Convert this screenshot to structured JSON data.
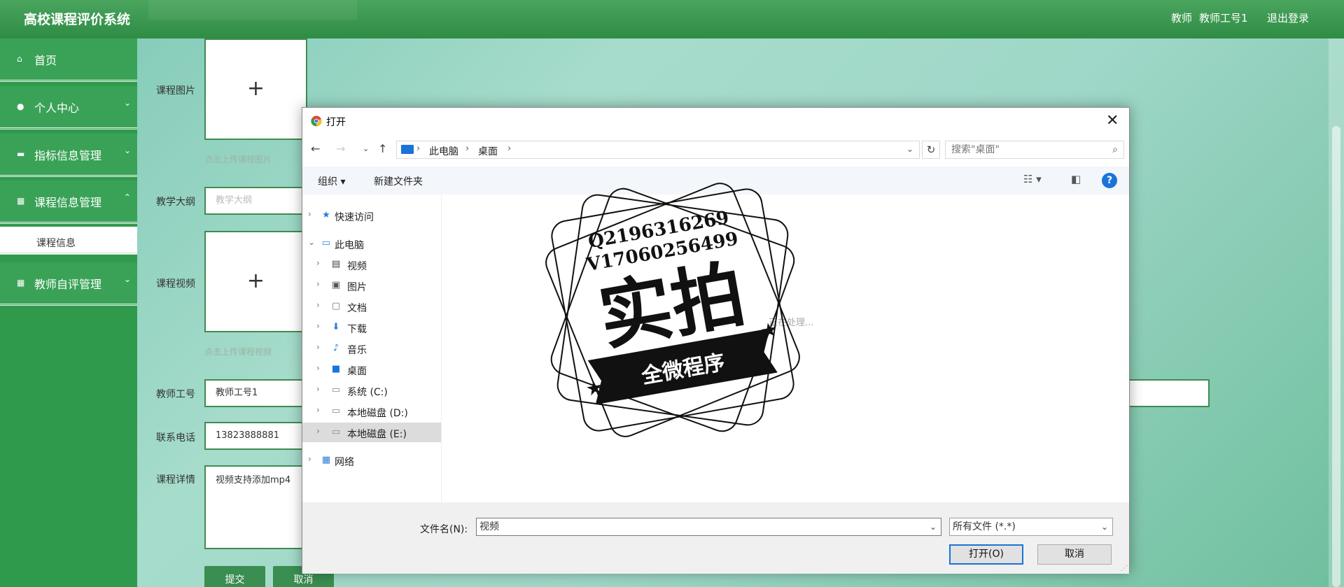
{
  "header": {
    "app_title": "高校课程评价系统",
    "role": "教师",
    "username": "教师工号1",
    "logout": "退出登录"
  },
  "sidebar": {
    "items": [
      {
        "label": "首页",
        "icon": "home-icon"
      },
      {
        "label": "个人中心",
        "icon": "user-icon"
      },
      {
        "label": "指标信息管理",
        "icon": "monitor-icon"
      },
      {
        "label": "课程信息管理",
        "icon": "grid-icon"
      },
      {
        "label": "课程信息",
        "icon": ""
      },
      {
        "label": "教师自评管理",
        "icon": "grid-icon"
      }
    ]
  },
  "form": {
    "course_image_label": "课程图片",
    "course_image_hint": "点击上传课程图片",
    "syllabus_label": "教学大纲",
    "syllabus_placeholder": "教学大纲",
    "course_video_label": "课程视频",
    "course_video_hint": "点击上传课程视频",
    "teacher_id_label": "教师工号",
    "teacher_id_value": "教师工号1",
    "phone_label": "联系电话",
    "phone_value": "13823888881",
    "details_label": "课程详情",
    "details_value": "视频支持添加mp4",
    "submit": "提交",
    "cancel": "取消"
  },
  "dialog": {
    "title": "打开",
    "breadcrumb": [
      "此电脑",
      "桌面"
    ],
    "search_placeholder": "搜索\"桌面\"",
    "organize": "组织 ▾",
    "new_folder": "新建文件夹",
    "processing": "正在处理...",
    "tree": [
      {
        "label": "快速访问",
        "icon": "star-icon",
        "level": 0,
        "expanded": false
      },
      {
        "label": "此电脑",
        "icon": "computer-icon",
        "level": 0,
        "expanded": true
      },
      {
        "label": "视频",
        "icon": "video-folder-icon",
        "level": 1
      },
      {
        "label": "图片",
        "icon": "pictures-folder-icon",
        "level": 1
      },
      {
        "label": "文档",
        "icon": "documents-folder-icon",
        "level": 1
      },
      {
        "label": "下载",
        "icon": "download-folder-icon",
        "level": 1
      },
      {
        "label": "音乐",
        "icon": "music-folder-icon",
        "level": 1
      },
      {
        "label": "桌面",
        "icon": "desktop-folder-icon",
        "level": 1
      },
      {
        "label": "系统 (C:)",
        "icon": "drive-icon",
        "level": 1
      },
      {
        "label": "本地磁盘 (D:)",
        "icon": "drive-icon",
        "level": 1
      },
      {
        "label": "本地磁盘 (E:)",
        "icon": "drive-icon",
        "level": 1,
        "selected": true
      },
      {
        "label": "网络",
        "icon": "network-icon",
        "level": 0
      }
    ],
    "filename_label": "文件名(N):",
    "filename_value": "视频",
    "filetype_value": "所有文件 (*.*)",
    "open_button": "打开(O)",
    "cancel_button": "取消"
  },
  "watermark": {
    "line1": "Q2196316269",
    "line2": "V17060256499",
    "big": "实拍",
    "banner": "全微程序"
  }
}
